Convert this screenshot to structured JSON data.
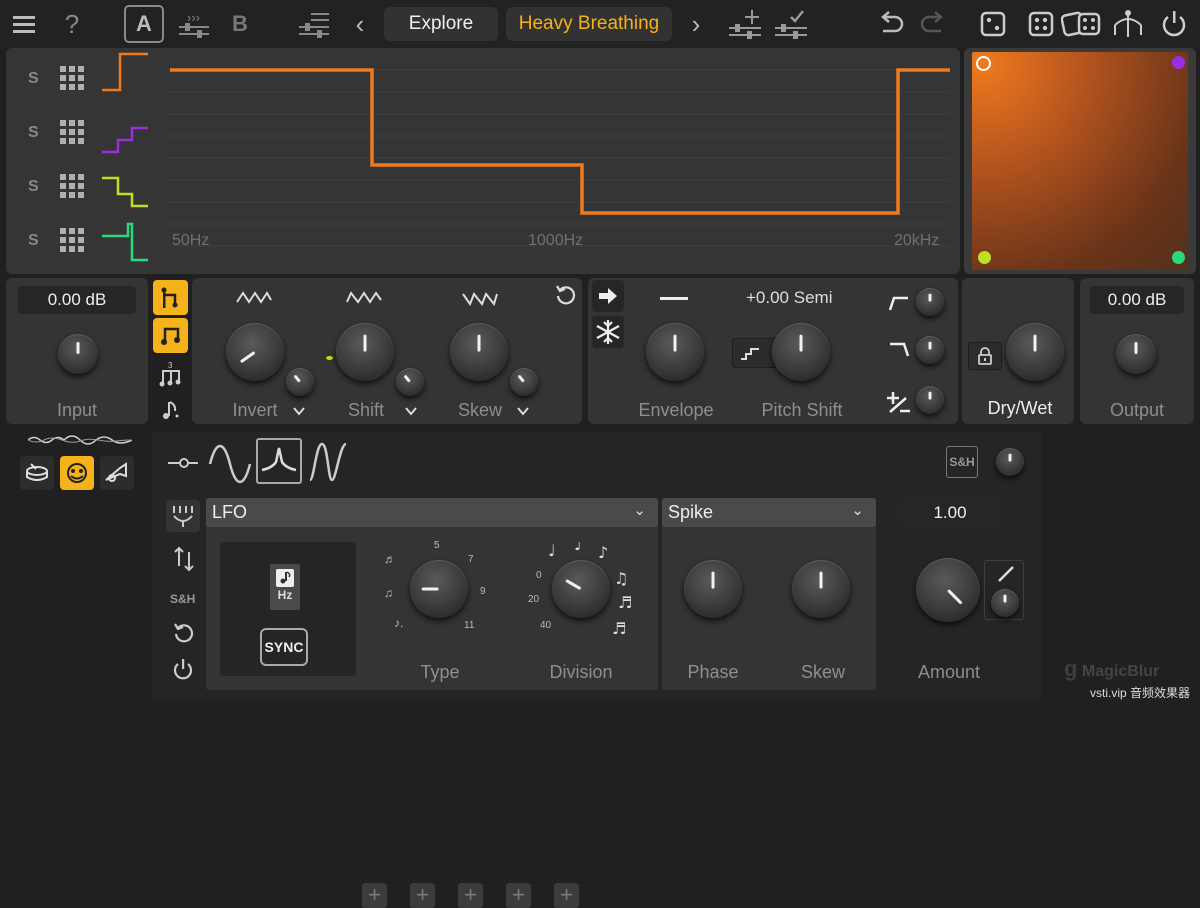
{
  "topbar": {
    "preset_a": "A",
    "preset_b": "B",
    "explore_label": "Explore",
    "preset_name": "Heavy Breathing",
    "prev_arrow": "‹",
    "next_arrow": "›",
    "help_label": "?"
  },
  "graph": {
    "freq_low": "50Hz",
    "freq_mid": "1000Hz",
    "freq_high": "20kHz",
    "solo_labels": [
      "S",
      "S",
      "S",
      "S"
    ],
    "band_colors": [
      "#f07a1e",
      "#9b2fe0",
      "#bde022",
      "#2bd97a"
    ],
    "curve_color": "#f07a1e"
  },
  "xy_pad": {
    "corner_colors": [
      "#f07a1e",
      "#9b2fe0",
      "#bde022",
      "#2bd97a"
    ]
  },
  "input": {
    "value": "0.00 dB",
    "label": "Input"
  },
  "output": {
    "value": "0.00 dB",
    "label": "Output"
  },
  "shape_section": {
    "invert_label": "Invert",
    "shift_label": "Shift",
    "skew_label": "Skew"
  },
  "pitch_section": {
    "pitch_value": "+0.00 Semi",
    "envelope_label": "Envelope",
    "pitch_label": "Pitch Shift"
  },
  "drywet": {
    "label": "Dry/Wet"
  },
  "modulator": {
    "sh_label": "S&H",
    "lfo_type": "LFO",
    "lfo_shape": "Spike",
    "hz_label": "Hz",
    "sync_label": "SYNC",
    "type_label": "Type",
    "division_label": "Division",
    "phase_label": "Phase",
    "skew_label": "Skew",
    "amount_value": "1.00",
    "amount_label": "Amount",
    "type_ticks": [
      "5",
      "7",
      "9",
      "11"
    ],
    "division_ticks": [
      "0",
      "20",
      "40"
    ]
  },
  "watermark": {
    "brand": "MagicBlur",
    "site": "vsti.vip 音频效果器"
  },
  "accent_color": "#f5b21a"
}
